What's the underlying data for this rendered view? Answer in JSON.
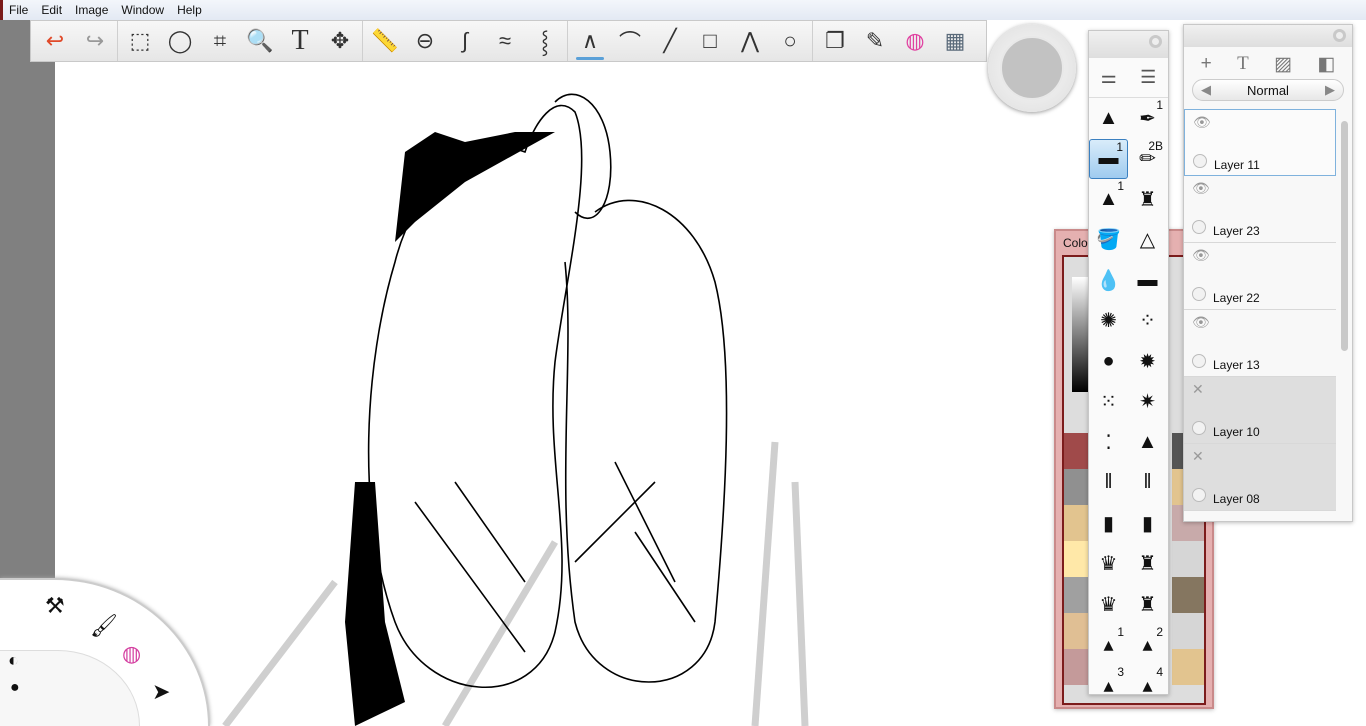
{
  "menu": [
    "File",
    "Edit",
    "Image",
    "Window",
    "Help"
  ],
  "toolbar": {
    "tools": [
      {
        "name": "undo",
        "glyph": "↩",
        "color": "#e04a2a"
      },
      {
        "name": "redo",
        "glyph": "↪",
        "color": "#999"
      },
      {
        "sep": true
      },
      {
        "name": "rect-select",
        "glyph": "⬚"
      },
      {
        "name": "lasso",
        "glyph": "◯"
      },
      {
        "name": "crop",
        "glyph": "⌗"
      },
      {
        "name": "zoom",
        "glyph": "🔍"
      },
      {
        "name": "text",
        "glyph": "T"
      },
      {
        "name": "move",
        "glyph": "✥"
      },
      {
        "sep": true
      },
      {
        "name": "ruler",
        "glyph": "📏"
      },
      {
        "name": "ellipse-guide",
        "glyph": "⊖"
      },
      {
        "name": "french-curve",
        "glyph": "∫"
      },
      {
        "name": "symmetry-x",
        "glyph": "≈"
      },
      {
        "name": "symmetry-y",
        "glyph": "⸾"
      },
      {
        "sep": true
      },
      {
        "name": "freehand",
        "glyph": "∧",
        "selected": true
      },
      {
        "name": "curve",
        "glyph": "⌒"
      },
      {
        "name": "line",
        "glyph": "╱"
      },
      {
        "name": "rectangle",
        "glyph": "□"
      },
      {
        "name": "polyline",
        "glyph": "⋀"
      },
      {
        "name": "ellipse",
        "glyph": "○"
      },
      {
        "sep": true
      },
      {
        "name": "copy-paste",
        "glyph": "❐"
      },
      {
        "name": "brushes",
        "glyph": "✎"
      },
      {
        "name": "color-wheel",
        "glyph": "◍",
        "color": "#e040a0"
      },
      {
        "name": "palette",
        "glyph": "▦",
        "color": "#5a6a7a"
      }
    ]
  },
  "brushes": {
    "items": [
      {
        "name": "airbrush",
        "glyph": "▲"
      },
      {
        "name": "pen",
        "glyph": "✒",
        "num": "1"
      },
      {
        "name": "eraser",
        "glyph": "▬",
        "num": "1",
        "selected": true
      },
      {
        "name": "pencil",
        "glyph": "✏",
        "num": "2B"
      },
      {
        "name": "ballpoint",
        "glyph": "▲",
        "num": "1"
      },
      {
        "name": "marker",
        "glyph": "♜"
      },
      {
        "name": "paint-bucket",
        "glyph": "🪣"
      },
      {
        "name": "smudge",
        "glyph": "△"
      },
      {
        "name": "blur",
        "glyph": "💧"
      },
      {
        "name": "sharpen",
        "glyph": "▬"
      },
      {
        "name": "splatter-1",
        "glyph": "✺"
      },
      {
        "name": "splatter-2",
        "glyph": "⁘"
      },
      {
        "name": "splatter-3",
        "glyph": "●"
      },
      {
        "name": "splatter-4",
        "glyph": "✹"
      },
      {
        "name": "splatter-5",
        "glyph": "⁙"
      },
      {
        "name": "splatter-6",
        "glyph": "✷"
      },
      {
        "name": "speckle",
        "glyph": "⁚"
      },
      {
        "name": "ink-stamp",
        "glyph": "▲"
      },
      {
        "name": "round-brush",
        "glyph": "ǁ"
      },
      {
        "name": "fan-brush",
        "glyph": "ǁ"
      },
      {
        "name": "flat-brush",
        "glyph": "▮"
      },
      {
        "name": "angle-brush",
        "glyph": "▮"
      },
      {
        "name": "bristle-1",
        "glyph": "♛"
      },
      {
        "name": "bristle-2",
        "glyph": "♜"
      },
      {
        "name": "bristle-3",
        "glyph": "♛"
      },
      {
        "name": "bristle-4",
        "glyph": "♜"
      },
      {
        "name": "preset-1",
        "glyph": "▴",
        "num": "1"
      },
      {
        "name": "preset-2",
        "glyph": "▴",
        "num": "2"
      },
      {
        "name": "preset-3",
        "glyph": "▴",
        "num": "3"
      },
      {
        "name": "preset-4",
        "glyph": "▴",
        "num": "4"
      }
    ]
  },
  "color_panel": {
    "title": "Colo",
    "left_swatches": [
      "#a04a4a",
      "#909090",
      "#e2c48f",
      "#ffe8a8",
      "#a0a0a0",
      "#e0bf94",
      "#c49a9a"
    ],
    "right_swatches": [
      "#555555",
      "#e2c48f",
      "#c8aaaa",
      "#d6d6d6",
      "#857660",
      "#d6d6d6",
      "#e2c48f"
    ]
  },
  "layers": {
    "blend_mode": "Normal",
    "items": [
      {
        "name": "Layer 11",
        "visible": true,
        "selected": true
      },
      {
        "name": "Layer 23",
        "visible": true
      },
      {
        "name": "Layer 22",
        "visible": true
      },
      {
        "name": "Layer 13",
        "visible": true
      },
      {
        "name": "Layer 10",
        "visible": false
      },
      {
        "name": "Layer 08",
        "visible": false
      }
    ]
  }
}
